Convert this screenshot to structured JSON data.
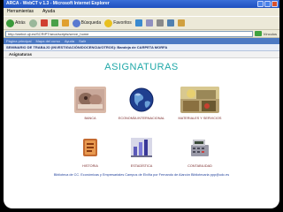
{
  "window": {
    "title": "ARCA - WebCT v 1.3 - Microsoft Internet Explorer"
  },
  "menu": {
    "items": [
      "Herramientas",
      "Ayuda"
    ]
  },
  "toolbar": {
    "back_label": "Atrás",
    "search_label": "Búsqueda",
    "favorites_label": "Favoritos"
  },
  "address": {
    "value": "http://webct.uji.es/SCRIPT/arca/scripts/serve_home",
    "links_label": "Vínculos"
  },
  "app_nav": {
    "items": [
      "Página principal",
      "Mapa del curso",
      "Ayuda",
      "Salir"
    ]
  },
  "path": {
    "text": "SEMINARIO DE TRABAJO (INVESTIGACIÓN/DOCENCIA/OTROS): Bandeja de CARPETA MORFA"
  },
  "section": {
    "title": "Asignaturas"
  },
  "content": {
    "heading": "ASIGNATURAS",
    "subjects": [
      {
        "label": "BANCA",
        "icon": "banking-image"
      },
      {
        "label": "ECONOMÍA INTERNACIONAL",
        "icon": "globe-image"
      },
      {
        "label": "MATERIALES Y SERVICIOS",
        "icon": "materials-image"
      },
      {
        "label": "HISTORIA",
        "icon": "history-image"
      },
      {
        "label": "ESTADÍSTICA",
        "icon": "statistics-image"
      },
      {
        "label": "CONTABILIDAD",
        "icon": "accounting-image"
      }
    ]
  },
  "footer": {
    "text": "Biblioteca de CC. Económicas y Empresariales Campus de Elviña por Fernando de Alarcón Bibliotecaria ppp@udc.es"
  },
  "colors": {
    "heading": "#1fa8a8",
    "label": "#7a2b2b",
    "footer": "#1f3f9a"
  }
}
